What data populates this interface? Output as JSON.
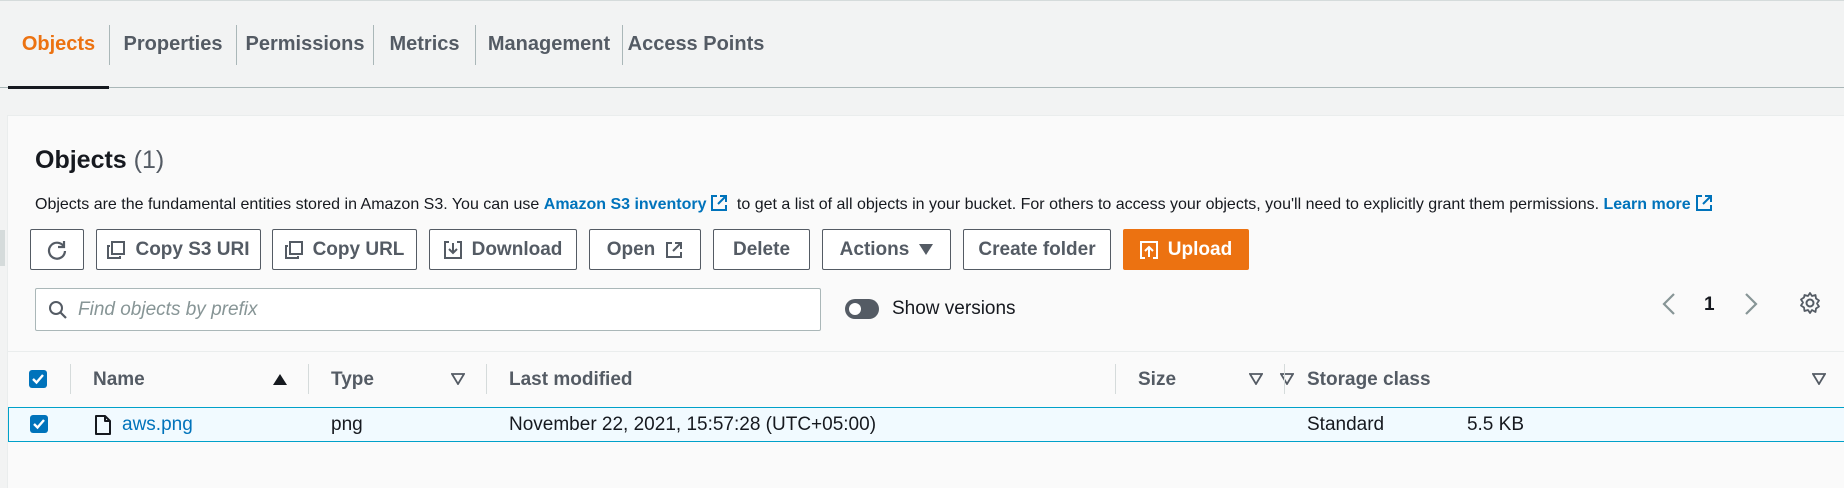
{
  "tabs": [
    {
      "label": "Objects",
      "active": true
    },
    {
      "label": "Properties",
      "active": false
    },
    {
      "label": "Permissions",
      "active": false
    },
    {
      "label": "Metrics",
      "active": false
    },
    {
      "label": "Management",
      "active": false
    },
    {
      "label": "Access Points",
      "active": false
    }
  ],
  "objects_panel": {
    "title": "Objects",
    "count": "(1)",
    "description": {
      "part1": "Objects are the fundamental entities stored in Amazon S3. You can use ",
      "link1": "Amazon S3 inventory",
      "part2": " to get a list of all objects in your bucket. For others to access your objects, you'll need to explicitly grant them permissions. ",
      "link2": "Learn more"
    }
  },
  "toolbar": {
    "refresh_icon": "refresh-icon",
    "copy_s3_uri": "Copy S3 URI",
    "copy_url": "Copy URL",
    "download": "Download",
    "open": "Open",
    "delete": "Delete",
    "actions": "Actions",
    "create_folder": "Create folder",
    "upload": "Upload"
  },
  "search": {
    "placeholder": "Find objects by prefix",
    "value": ""
  },
  "show_versions": {
    "label": "Show versions",
    "enabled": false
  },
  "pagination": {
    "current_page": "1"
  },
  "table": {
    "columns": [
      {
        "label": "Name",
        "sort": "ascending"
      },
      {
        "label": "Type",
        "sort": "none"
      },
      {
        "label": "Last modified",
        "sort": "none"
      },
      {
        "label": "Size",
        "sort": "none"
      },
      {
        "label": "Storage class",
        "sort": "none"
      }
    ],
    "rows": [
      {
        "selected": true,
        "name": "aws.png",
        "type": "png",
        "last_modified": "November 22, 2021, 15:57:28 (UTC+05:00)",
        "size": "5.5 KB",
        "storage_class": "Standard"
      }
    ]
  },
  "colors": {
    "accent": "#ec7211",
    "link": "#0073bb",
    "selected_row_bg": "#f1faff",
    "selected_row_border": "#00a1c9"
  }
}
